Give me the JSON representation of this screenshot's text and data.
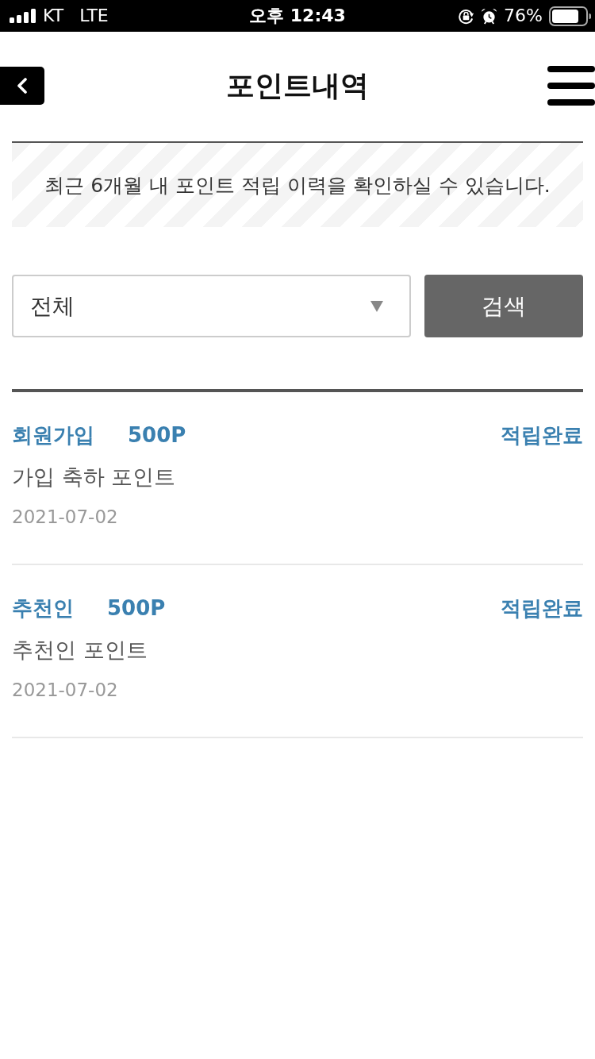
{
  "status_bar": {
    "carrier": "KT",
    "network": "LTE",
    "time": "오후 12:43",
    "battery": "76%"
  },
  "header": {
    "title": "포인트내역"
  },
  "notice": "최근 6개월 내 포인트 적립 이력을 확인하실 수 있습니다.",
  "filter": {
    "value": "전체",
    "button": "검색"
  },
  "history": [
    {
      "category": "회원가입",
      "points": "500P",
      "status": "적립완료",
      "description": "가입 축하 포인트",
      "date": "2021-07-02"
    },
    {
      "category": "추천인",
      "points": "500P",
      "status": "적립완료",
      "description": "추천인 포인트",
      "date": "2021-07-02"
    }
  ]
}
